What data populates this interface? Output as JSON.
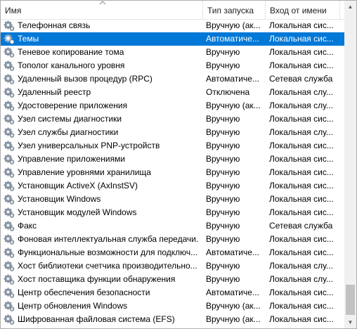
{
  "columns": {
    "name": "Имя",
    "startup_type": "Тип запуска",
    "logon_as": "Вход от имени"
  },
  "selected_index": 1,
  "rows": [
    {
      "name": "Телефонная связь",
      "type": "Вручную (ак...",
      "logon": "Локальная сис..."
    },
    {
      "name": "Темы",
      "type": "Автоматиче...",
      "logon": "Локальная сис..."
    },
    {
      "name": "Теневое копирование тома",
      "type": "Вручную",
      "logon": "Локальная сис..."
    },
    {
      "name": "Тополог канального уровня",
      "type": "Вручную",
      "logon": "Локальная сис..."
    },
    {
      "name": "Удаленный вызов процедур (RPC)",
      "type": "Автоматиче...",
      "logon": "Сетевая служба"
    },
    {
      "name": "Удаленный реестр",
      "type": "Отключена",
      "logon": "Локальная слу..."
    },
    {
      "name": "Удостоверение приложения",
      "type": "Вручную (ак...",
      "logon": "Локальная слу..."
    },
    {
      "name": "Узел системы диагностики",
      "type": "Вручную",
      "logon": "Локальная сис..."
    },
    {
      "name": "Узел службы диагностики",
      "type": "Вручную",
      "logon": "Локальная слу..."
    },
    {
      "name": "Узел универсальных PNP-устройств",
      "type": "Вручную",
      "logon": "Локальная сис..."
    },
    {
      "name": "Управление приложениями",
      "type": "Вручную",
      "logon": "Локальная сис..."
    },
    {
      "name": "Управление уровнями хранилища",
      "type": "Вручную",
      "logon": "Локальная сис..."
    },
    {
      "name": "Установщик ActiveX (AxInstSV)",
      "type": "Вручную",
      "logon": "Локальная сис..."
    },
    {
      "name": "Установщик Windows",
      "type": "Вручную",
      "logon": "Локальная сис..."
    },
    {
      "name": "Установщик модулей Windows",
      "type": "Вручную",
      "logon": "Локальная сис..."
    },
    {
      "name": "Факс",
      "type": "Вручную",
      "logon": "Сетевая служба"
    },
    {
      "name": "Фоновая интеллектуальная служба передачи...",
      "type": "Вручную",
      "logon": "Локальная сис..."
    },
    {
      "name": "Функциональные возможности для подключ...",
      "type": "Автоматиче...",
      "logon": "Локальная сис..."
    },
    {
      "name": "Хост библиотеки счетчика производительно...",
      "type": "Вручную",
      "logon": "Локальная слу..."
    },
    {
      "name": "Хост поставщика функции обнаружения",
      "type": "Вручную",
      "logon": "Локальная слу..."
    },
    {
      "name": "Центр обеспечения безопасности",
      "type": "Автоматиче...",
      "logon": "Локальная сис..."
    },
    {
      "name": "Центр обновления Windows",
      "type": "Вручную (ак...",
      "logon": "Локальная сис..."
    },
    {
      "name": "Шифрованная файловая система (EFS)",
      "type": "Вручную (ак...",
      "logon": "Локальная сис..."
    }
  ],
  "colors": {
    "selection": "#0078d7",
    "header_separator": "#e5e5e5",
    "scrollbar_track": "#f0f0f0",
    "scrollbar_thumb": "#c2c2c2"
  },
  "icons": {
    "sort": "sort-ascending-icon",
    "service": "service-gear-icon",
    "scroll_up": "scroll-up-arrow-icon",
    "scroll_down": "scroll-down-arrow-icon"
  }
}
